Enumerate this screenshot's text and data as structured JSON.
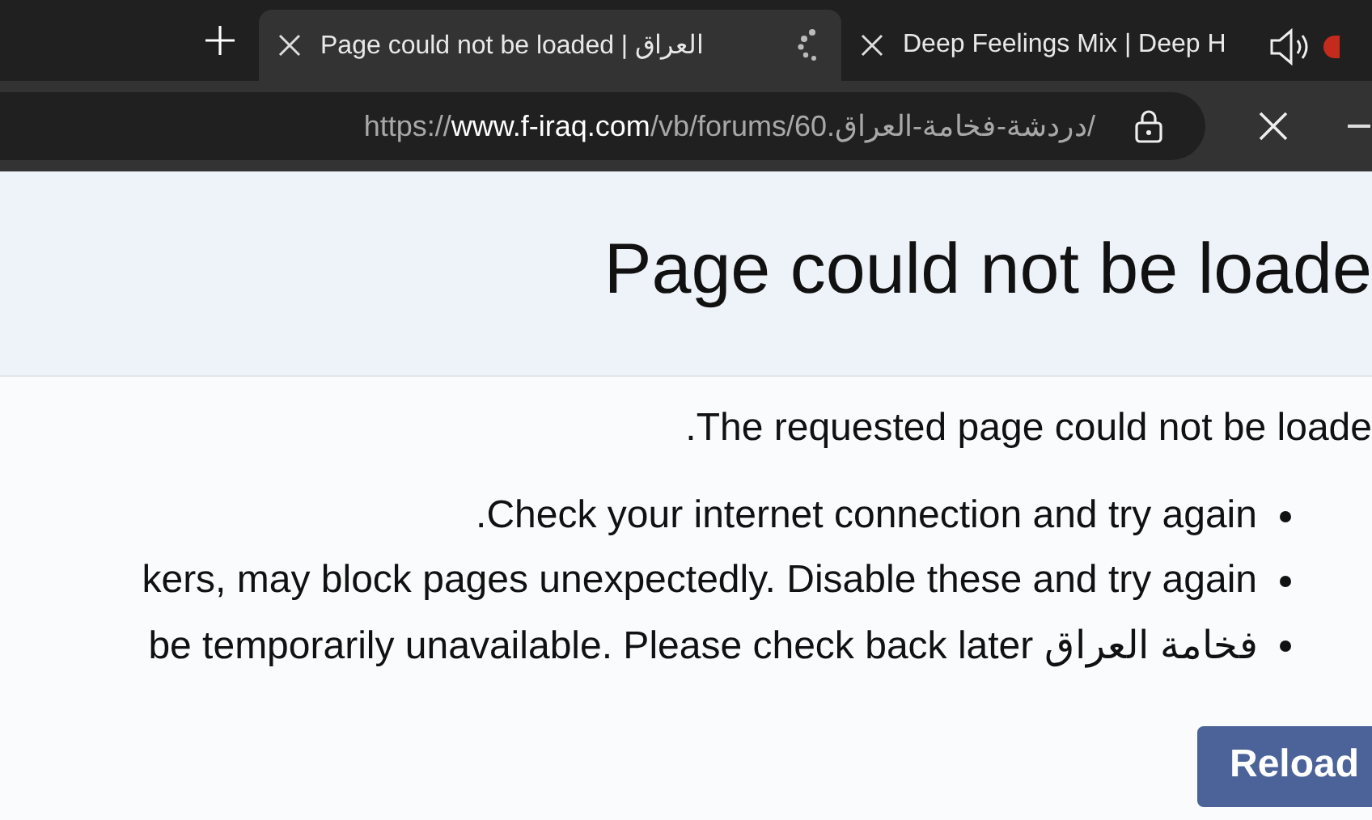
{
  "tabs": [
    {
      "title": "Page could not be loaded | العراق",
      "selected": true,
      "loading": true
    },
    {
      "title": "Deep Feelings Mix | Deep H",
      "selected": false,
      "loading": false
    }
  ],
  "address_bar": {
    "scheme": "https://",
    "domain": "www.f-iraq.com",
    "path": "/vb/forums/60.دردشة-فخامة-العراق/"
  },
  "page": {
    "heading": "Page could not be loade",
    "message": "The requested page could not be loade.",
    "bullets": [
      "Check your internet connection and try again.",
      "kers, may block pages unexpectedly. Disable these and try again",
      "فخامة العراق be temporarily unavailable. Please check back later"
    ],
    "button": "Reload"
  }
}
